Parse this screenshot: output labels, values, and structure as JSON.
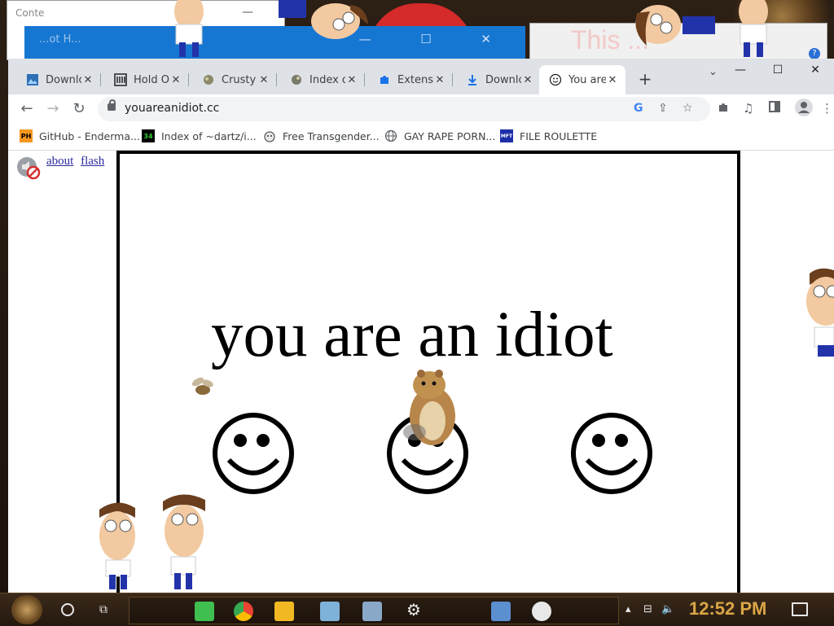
{
  "background": {
    "left_window_title": "Conte",
    "holdon_window_title": "...ot H...",
    "holdon_window_controls": "— ☐ ✕",
    "right_window_faded_text": "This ...",
    "right_window_help": "?"
  },
  "browser": {
    "tabs": [
      {
        "title": "Downloa",
        "icon": "image-favicon"
      },
      {
        "title": "Hold On",
        "icon": "building-favicon"
      },
      {
        "title": "Crusty",
        "icon": "crusty-favicon"
      },
      {
        "title": "Index o",
        "icon": "index-favicon"
      },
      {
        "title": "Extensi",
        "icon": "puzzle-favicon"
      },
      {
        "title": "Downlo",
        "icon": "download-favicon"
      },
      {
        "title": "You are",
        "icon": "smiley-favicon",
        "active": true
      }
    ],
    "new_tab_label": "+",
    "tab_search": "⌄",
    "window_controls": {
      "minimize": "—",
      "maximize": "☐",
      "close": "✕"
    },
    "toolbar": {
      "url": "youareanidiot.cc"
    },
    "bookmarks": [
      {
        "label": "GitHub - Enderma...",
        "icon": "PH"
      },
      {
        "label": "Index of ~dartz/i...",
        "icon": "34"
      },
      {
        "label": "Free Transgender...",
        "icon": "dog"
      },
      {
        "label": "GAY RAPE PORN...",
        "icon": "globe"
      },
      {
        "label": "FILE ROULETTE",
        "icon": "MFT"
      }
    ]
  },
  "page": {
    "links": {
      "about": "about",
      "flash": "flash"
    },
    "headline": "you are an idiot"
  },
  "taskbar": {
    "clock": "12:52 PM"
  },
  "colors": {
    "tabstrip": "#dee1e6",
    "link": "#2c2c9e",
    "clock": "#d9a647",
    "taskbar": "#2e2014"
  }
}
